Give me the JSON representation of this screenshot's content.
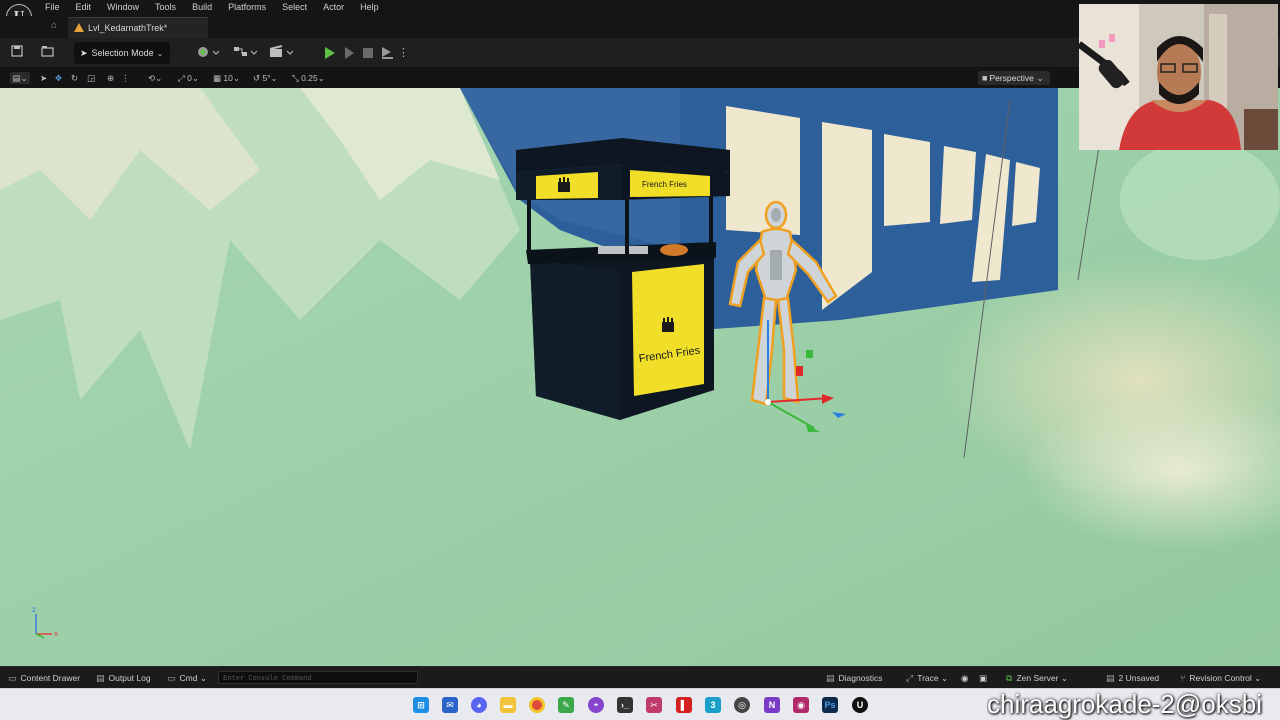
{
  "menubar": {
    "items": [
      "File",
      "Edit",
      "Window",
      "Tools",
      "Build",
      "Platforms",
      "Select",
      "Actor",
      "Help"
    ]
  },
  "level_tab": {
    "label": "Lvl_KedarnathTrek*"
  },
  "toolbar": {
    "selection_mode": "Selection Mode"
  },
  "viewport_toolbar": {
    "grid_snap_value": "0",
    "location_snap_value": "10",
    "rotation_snap_value": "5°",
    "scale_snap_value": "0.25",
    "perspective_label": "Perspective"
  },
  "scene": {
    "stall_sign_text": "French Fries",
    "stall_top_sign_text": "French Fries",
    "axis_z": "z",
    "axis_x": "x"
  },
  "statusbar": {
    "content_drawer": "Content Drawer",
    "output_log": "Output Log",
    "cmd": "Cmd",
    "console_placeholder": "Enter Console Command",
    "diagnostics": "Diagnostics",
    "trace": "Trace",
    "zen_server": "Zen Server",
    "unsaved": "2 Unsaved",
    "revision_control": "Revision Control"
  },
  "watermark": "chiraagrokade-2@oksbi",
  "colors": {
    "play_green": "#5fc043",
    "selection_outline": "#f0a020",
    "floor_green": "#9ccfa8",
    "wall_blue": "#2d5f9a",
    "stall_yellow": "#f0de28"
  },
  "icons": {
    "toolbar": [
      "save-icon",
      "content-browser-icon",
      "add-actor-icon",
      "blueprint-icon",
      "cinematics-icon",
      "play-icon",
      "step-icon",
      "stop-icon",
      "eject-icon",
      "more-icon"
    ],
    "taskbar": [
      "windows-start-icon",
      "mail-icon",
      "discord-icon",
      "file-explorer-icon",
      "chrome-icon",
      "notepad-icon",
      "github-icon",
      "terminal-icon",
      "snipping-icon",
      "red-app-icon",
      "3d-app-icon",
      "search-icon",
      "visual-studio-icon",
      "davinci-icon",
      "photoshop-icon",
      "unreal-icon"
    ]
  }
}
